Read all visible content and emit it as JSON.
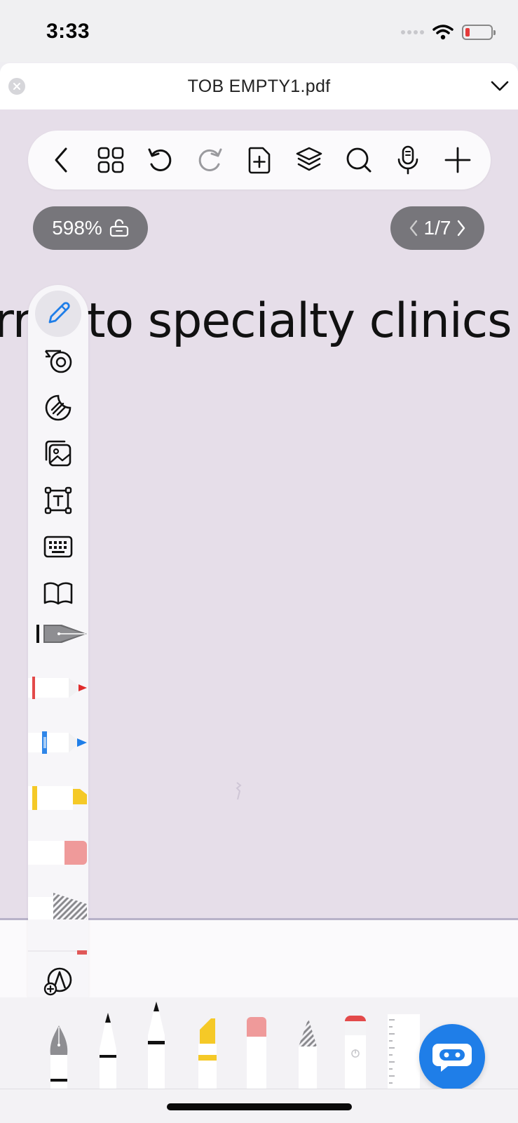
{
  "status_bar": {
    "time": "3:33"
  },
  "title_bar": {
    "file_name": "TOB EMPTY1.pdf"
  },
  "toolbar": {
    "items": [
      "back-icon",
      "grid-icon",
      "undo-icon",
      "redo-icon",
      "add-page-icon",
      "layers-icon",
      "search-icon",
      "microphone-icon",
      "plus-icon"
    ]
  },
  "zoom": {
    "label": "598%"
  },
  "pagination": {
    "label": "1/7"
  },
  "document": {
    "visible_text": "rral to specialty clinics"
  },
  "side_toolbar": {
    "tools": [
      "pencil-icon",
      "tape-icon",
      "sticker-icon",
      "image-icon",
      "text-box-icon",
      "keyboard-icon",
      "book-icon",
      "fountain-pen-icon",
      "red-pen-icon",
      "blue-pen-icon",
      "yellow-highlighter-icon",
      "eraser-icon",
      "lasso-icon",
      "add-tool-icon"
    ],
    "active_tool": "pencil-icon"
  },
  "colors": {
    "canvas": "#e6dee9",
    "accent": "#1f7ee8",
    "pill_bg": "#77767b"
  }
}
